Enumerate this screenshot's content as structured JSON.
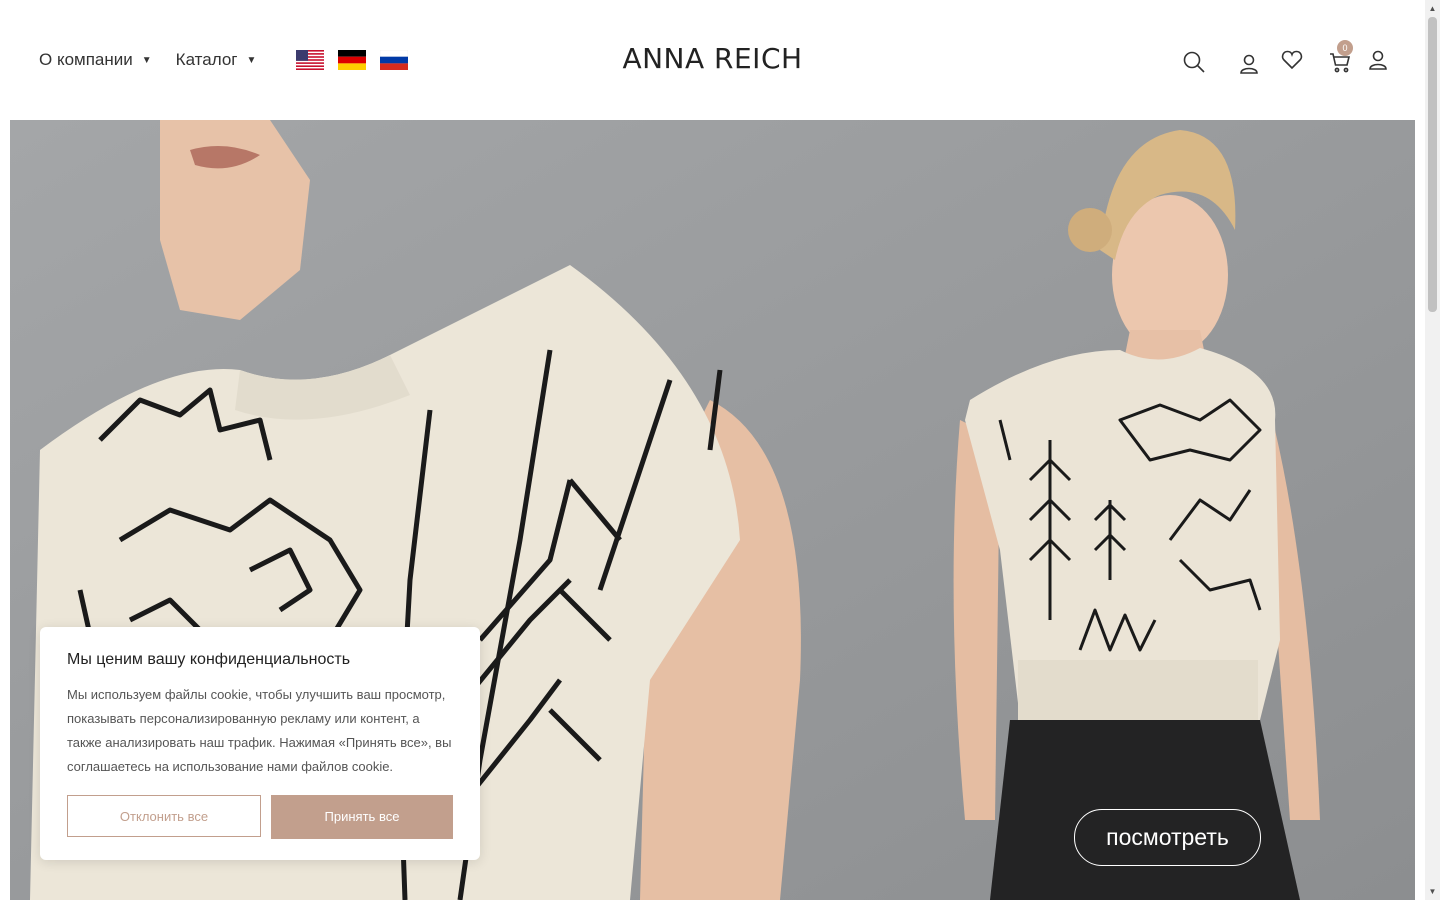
{
  "header": {
    "nav": [
      {
        "label": "О компании"
      },
      {
        "label": "Каталог"
      }
    ],
    "languages": [
      "english-flag-icon",
      "german-flag-icon",
      "russian-flag-icon"
    ],
    "logo": "ANNA REICH",
    "icons": [
      "search-icon",
      "account-icon",
      "wishlist-heart-icon",
      "cart-icon",
      "user-icon"
    ],
    "cart_count": "0"
  },
  "hero": {
    "button_label": "посмотреть"
  },
  "cookie_banner": {
    "title": "Мы ценим вашу конфиденциальность",
    "text": "Мы используем файлы cookie, чтобы улучшить ваш просмотр, показывать персонализированную рекламу или контент, а также анализировать наш трафик. Нажимая «Принять все», вы соглашаетесь на использование нами файлов cookie.",
    "decline_label": "Отклонить все",
    "accept_label": "Принять все"
  },
  "colors": {
    "accent": "#c29f8d",
    "hero_background": "#97999b"
  }
}
